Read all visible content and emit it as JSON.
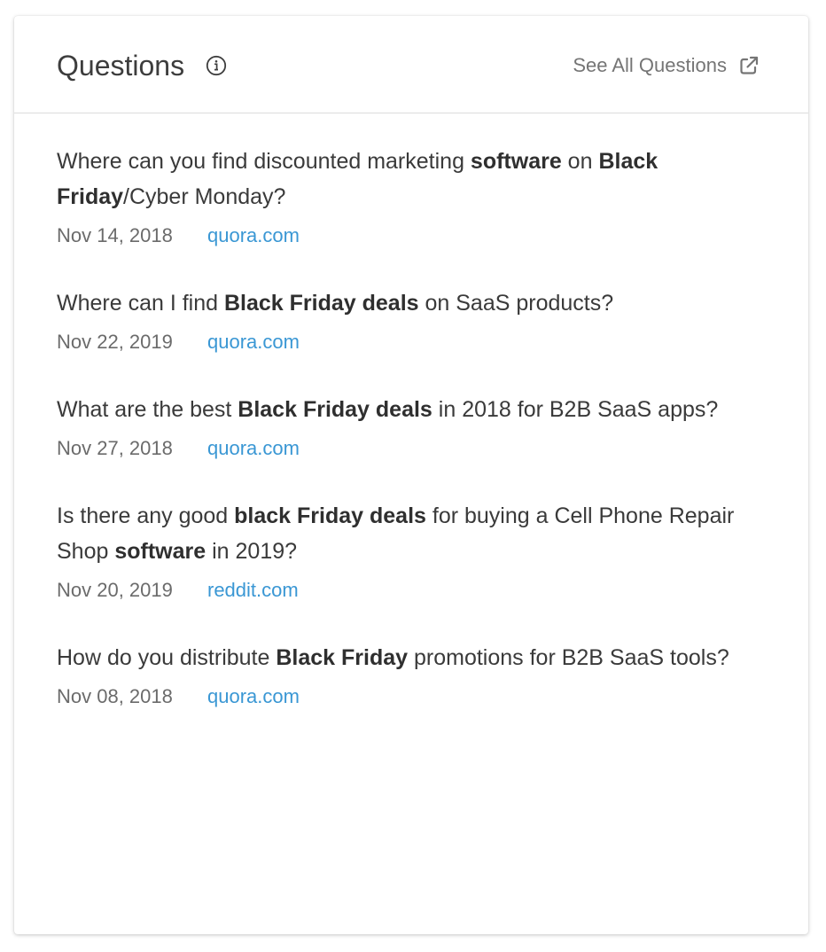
{
  "header": {
    "title": "Questions",
    "info_icon": "info-circle-icon",
    "see_all_label": "See All Questions",
    "see_all_icon": "external-link-icon"
  },
  "colors": {
    "link": "#3a97d4",
    "text": "#3a3a3a",
    "muted": "#6b6b6b",
    "divider": "#dcdcdc"
  },
  "questions": [
    {
      "segments": [
        {
          "text": "Where can you find discounted marketing ",
          "bold": false
        },
        {
          "text": "software",
          "bold": true
        },
        {
          "text": " on ",
          "bold": false
        },
        {
          "text": "Black Friday",
          "bold": true
        },
        {
          "text": "/Cyber Monday?",
          "bold": false
        }
      ],
      "date": "Nov 14, 2018",
      "source": "quora.com"
    },
    {
      "segments": [
        {
          "text": "Where can I find ",
          "bold": false
        },
        {
          "text": "Black Friday deals",
          "bold": true
        },
        {
          "text": " on SaaS products?",
          "bold": false
        }
      ],
      "date": "Nov 22, 2019",
      "source": "quora.com"
    },
    {
      "segments": [
        {
          "text": "What are the best ",
          "bold": false
        },
        {
          "text": "Black Friday deals",
          "bold": true
        },
        {
          "text": " in 2018 for B2B SaaS apps?",
          "bold": false
        }
      ],
      "date": "Nov 27, 2018",
      "source": "quora.com"
    },
    {
      "segments": [
        {
          "text": "Is there any good ",
          "bold": false
        },
        {
          "text": "black Friday deals",
          "bold": true
        },
        {
          "text": " for buying a Cell Phone Repair Shop ",
          "bold": false
        },
        {
          "text": "software",
          "bold": true
        },
        {
          "text": " in 2019?",
          "bold": false
        }
      ],
      "date": "Nov 20, 2019",
      "source": "reddit.com"
    },
    {
      "segments": [
        {
          "text": "How do you distribute ",
          "bold": false
        },
        {
          "text": "Black Friday",
          "bold": true
        },
        {
          "text": " promotions for B2B SaaS tools?",
          "bold": false
        }
      ],
      "date": "Nov 08, 2018",
      "source": "quora.com"
    }
  ]
}
